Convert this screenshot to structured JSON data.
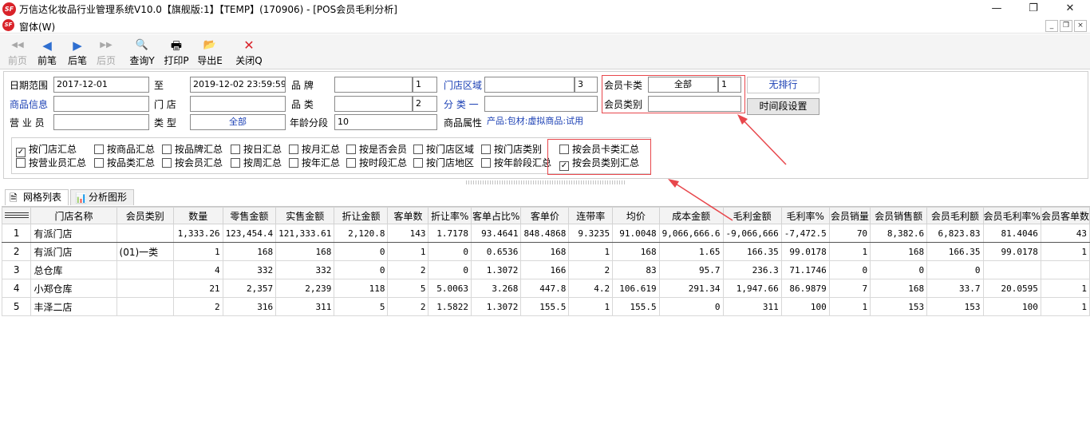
{
  "window": {
    "title": "万信达化妆品行业管理系统V10.0【旗舰版:1】【TEMP】(170906) - [POS会员毛利分析]",
    "logo_text": "SF",
    "controls": {
      "minimize": "—",
      "restore": "❐",
      "close": "✕"
    }
  },
  "menu": {
    "item": "窗体(W)",
    "mdi_controls": [
      "_",
      "❐",
      "×"
    ]
  },
  "toolbar": [
    {
      "label": "前页",
      "icon": "◀◀",
      "enabled": false
    },
    {
      "label": "前笔",
      "icon": "◀",
      "enabled": true
    },
    {
      "label": "后笔",
      "icon": "▶",
      "enabled": true
    },
    {
      "label": "后页",
      "icon": "▶▶",
      "enabled": false
    },
    {
      "label": "查询Y",
      "icon": "🔍",
      "enabled": true
    },
    {
      "label": "打印P",
      "icon": "🖶",
      "enabled": true
    },
    {
      "label": "导出E",
      "icon": "📂",
      "enabled": true
    },
    {
      "label": "关闭Q",
      "icon": "✕",
      "enabled": true
    }
  ],
  "filters": {
    "date_range_label": "日期范围",
    "date_from": "2017-12-01",
    "to_label": "至",
    "date_to": "2019-12-02 23:59:59",
    "brand_label": "品    牌",
    "brand_value": "",
    "brand_count": "1",
    "store_area_label": "门店区域",
    "store_area_value": "",
    "store_area_count": "3",
    "card_type_label": "会员卡类",
    "card_type_value": "全部",
    "card_type_count": "1",
    "no_sort_button": "无排行",
    "product_info_label": "商品信息",
    "product_info_value": "",
    "store_label": "门    店",
    "store_value": "",
    "category_label": "品    类",
    "category_value": "",
    "category_count": "2",
    "classify_label": "分  类  一",
    "classify_value": "",
    "member_category_label": "会员类别",
    "member_category_value": "",
    "time_period_button": "时间段设置",
    "salesperson_label": "营 业 员",
    "salesperson_value": "",
    "type_label": "类    型",
    "type_value": "全部",
    "age_group_label": "年龄分段",
    "age_group_value": "10",
    "product_attr_label": "商品属性",
    "product_attr_value": "产品:包材:虚拟商品:试用"
  },
  "checkboxes": {
    "row1": [
      {
        "label": "按门店汇总",
        "checked": true
      },
      {
        "label": "按商品汇总",
        "checked": false
      },
      {
        "label": "按品牌汇总",
        "checked": false
      },
      {
        "label": "按日汇总",
        "checked": false
      },
      {
        "label": "按月汇总",
        "checked": false
      },
      {
        "label": "按是否会员",
        "checked": false
      },
      {
        "label": "按门店区域",
        "checked": false
      },
      {
        "label": "按门店类别",
        "checked": false
      }
    ],
    "row2": [
      {
        "label": "按营业员汇总",
        "checked": false
      },
      {
        "label": "按品类汇总",
        "checked": false
      },
      {
        "label": "按会员汇总",
        "checked": false
      },
      {
        "label": "按周汇总",
        "checked": false
      },
      {
        "label": "按年汇总",
        "checked": false
      },
      {
        "label": "按时段汇总",
        "checked": false
      },
      {
        "label": "按门店地区",
        "checked": false
      },
      {
        "label": "按年龄段汇总",
        "checked": false
      }
    ],
    "member": [
      {
        "label": "按会员卡类汇总",
        "checked": false
      },
      {
        "label": "按会员类别汇总",
        "checked": true
      }
    ]
  },
  "tabs": [
    {
      "label": "网格列表",
      "icon": "🗎",
      "active": true
    },
    {
      "label": "分析图形",
      "icon": "📊",
      "active": false
    }
  ],
  "grid": {
    "columns": [
      "门店名称",
      "会员类别",
      "数量",
      "零售金额",
      "实售金额",
      "折让金额",
      "客单数",
      "折让率%",
      "客单占比%",
      "客单价",
      "连带率",
      "均价",
      "成本金额",
      "毛利金额",
      "毛利率%",
      "会员销量",
      "会员销售额",
      "会员毛利额",
      "会员毛利率%",
      "会员客单数"
    ],
    "rows": [
      [
        "有派门店",
        "",
        "1,333.26",
        "123,454.4",
        "121,333.61",
        "2,120.8",
        "143",
        "1.7178",
        "93.4641",
        "848.4868",
        "9.3235",
        "91.0048",
        "9,066,666.6",
        "-9,066,666",
        "-7,472.5",
        "70",
        "8,382.6",
        "6,823.83",
        "81.4046",
        "43"
      ],
      [
        "有派门店",
        "(01)一类",
        "1",
        "168",
        "168",
        "0",
        "1",
        "0",
        "0.6536",
        "168",
        "1",
        "168",
        "1.65",
        "166.35",
        "99.0178",
        "1",
        "168",
        "166.35",
        "99.0178",
        "1"
      ],
      [
        "总仓库",
        "",
        "4",
        "332",
        "332",
        "0",
        "2",
        "0",
        "1.3072",
        "166",
        "2",
        "83",
        "95.7",
        "236.3",
        "71.1746",
        "0",
        "0",
        "0",
        "",
        ""
      ],
      [
        "小郑仓库",
        "",
        "21",
        "2,357",
        "2,239",
        "118",
        "5",
        "5.0063",
        "3.268",
        "447.8",
        "4.2",
        "106.619",
        "291.34",
        "1,947.66",
        "86.9879",
        "7",
        "168",
        "33.7",
        "20.0595",
        "1"
      ],
      [
        "丰泽二店",
        "",
        "2",
        "316",
        "311",
        "5",
        "2",
        "1.5822",
        "1.3072",
        "155.5",
        "1",
        "155.5",
        "0",
        "311",
        "100",
        "1",
        "153",
        "153",
        "100",
        "1"
      ]
    ]
  },
  "colors": {
    "accent_red": "#e8474c",
    "link_blue": "#1a3fb4"
  }
}
